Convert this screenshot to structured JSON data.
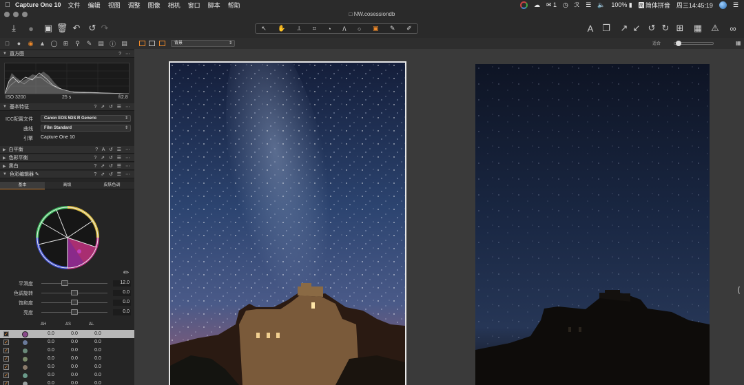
{
  "menubar": {
    "app_name": "Capture One 10",
    "menus": [
      "文件",
      "编辑",
      "视图",
      "调整",
      "图像",
      "相机",
      "窗口",
      "脚本",
      "帮助"
    ],
    "status": {
      "messages_count": "1",
      "battery": "100%",
      "ime_badge": "简",
      "input_method": "简体拼音",
      "clock": "周三14:45:19"
    }
  },
  "window": {
    "title": "NW.cosessiondb"
  },
  "toolbar": {
    "icons": [
      "import-icon",
      "camera-icon",
      "folder-icon",
      "trash-icon",
      "undo-icon",
      "redo-icon"
    ],
    "cursor_tools": [
      "↖",
      "✋",
      "⟂",
      "⌗",
      "◔",
      "/\\",
      "○",
      "▣",
      "✎",
      "✐"
    ],
    "active_cursor_tool": 7
  },
  "viewer_bar": {
    "view_select": "背景",
    "zoom_label": "适合"
  },
  "histogram": {
    "title": "直方图",
    "iso": "ISO 3200",
    "shutter": "25 s",
    "aperture": "f/2.8"
  },
  "base_characteristics": {
    "title": "基本特征",
    "icc_label": "ICC配置文件",
    "icc_value": "Canon EOS 5DS R Generic",
    "curve_label": "曲线",
    "curve_value": "Film Standard",
    "engine_label": "引擎",
    "engine_value": "Capture One 10"
  },
  "sections": {
    "white_balance": "白平衡",
    "color_balance": "色彩平衡",
    "black_white": "黑白",
    "color_editor": "色彩编辑器"
  },
  "color_editor": {
    "tabs": [
      "基本",
      "高级",
      "皮肤色调"
    ],
    "active_tab": 0,
    "sliders": [
      {
        "label": "平滑度",
        "value": "12.0",
        "position": 0.35
      },
      {
        "label": "色调旋转",
        "value": "0.0",
        "position": 0.5
      },
      {
        "label": "饱和度",
        "value": "0.0",
        "position": 0.5
      },
      {
        "label": "亮度",
        "value": "0.0",
        "position": 0.5
      }
    ],
    "table_headers": [
      "ΔH",
      "ΔS",
      "ΔL"
    ],
    "rows": [
      {
        "checked": "✓",
        "color": "#8a4a8a",
        "dh": "0.0",
        "ds": "0.0",
        "dl": "0.0",
        "selected": true
      },
      {
        "checked": "✓",
        "color": "#6a7a9a",
        "dh": "0.0",
        "ds": "0.0",
        "dl": "0.0",
        "selected": false
      },
      {
        "checked": "✓",
        "color": "#6a8a7a",
        "dh": "0.0",
        "ds": "0.0",
        "dl": "0.0",
        "selected": false
      },
      {
        "checked": "✓",
        "color": "#7a8a6a",
        "dh": "0.0",
        "ds": "0.0",
        "dl": "0.0",
        "selected": false
      },
      {
        "checked": "✓",
        "color": "#8a7a6a",
        "dh": "0.0",
        "ds": "0.0",
        "dl": "0.0",
        "selected": false
      },
      {
        "checked": "✓",
        "color": "#6a9a8a",
        "dh": "0.0",
        "ds": "0.0",
        "dl": "0.0",
        "selected": false
      },
      {
        "checked": "✓",
        "color": "#9aa0a0",
        "dh": "0.0",
        "ds": "0.0",
        "dl": "0.0",
        "selected": false
      }
    ]
  },
  "colors": {
    "accent": "#f08a2a",
    "panel_bg": "#252525",
    "viewer_bg": "#3a3a3a"
  }
}
